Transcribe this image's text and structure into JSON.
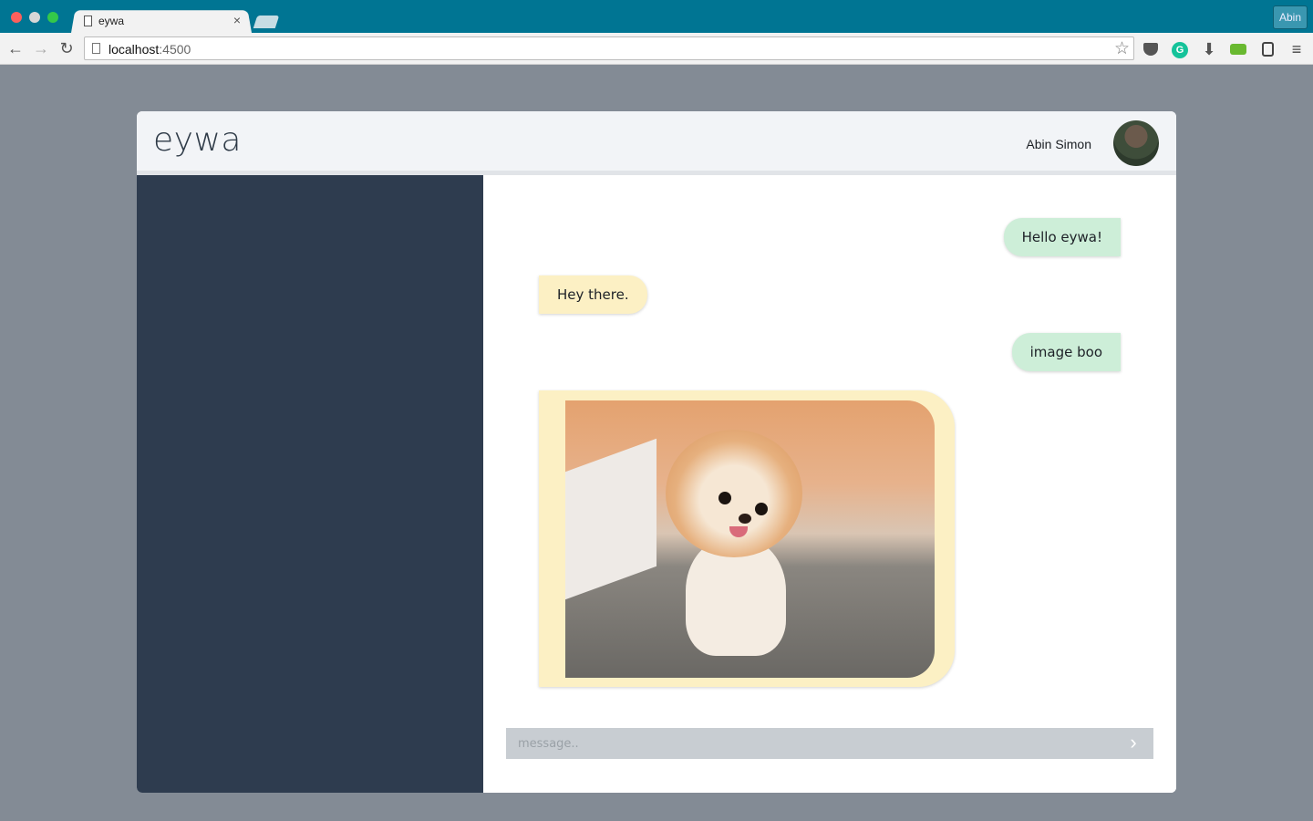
{
  "browser": {
    "tab_title": "eywa",
    "tab_close": "×",
    "profile_name": "Abin",
    "url_host": "localhost",
    "url_port": ":4500",
    "nav": {
      "back": "←",
      "forward": "→",
      "reload": "↻"
    },
    "star": "☆",
    "extensions": {
      "download": "⬇",
      "menu": "≡",
      "grammarly": "G"
    }
  },
  "app": {
    "logo": "eywa",
    "user_name": "Abin Simon"
  },
  "messages": [
    {
      "direction": "sent",
      "text": "Hello eywa!"
    },
    {
      "direction": "received",
      "text": "Hey there."
    },
    {
      "direction": "sent",
      "text": "image boo"
    },
    {
      "direction": "received",
      "type": "image",
      "alt": "pomeranian puppy"
    }
  ],
  "composer": {
    "placeholder": "message..",
    "send": "›"
  },
  "colors": {
    "page_bg": "#838b95",
    "titlebar": "#007593",
    "sidebar": "#2e3c4f",
    "sent_bubble": "#cdeed8",
    "received_bubble": "#fcf0c4",
    "composer_bg": "#c8cdd2"
  }
}
